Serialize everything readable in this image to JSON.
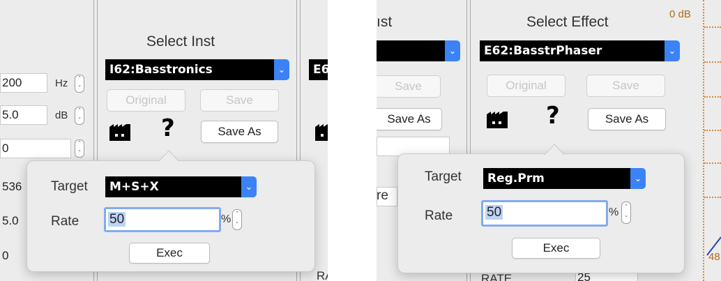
{
  "left": {
    "title": "Select Inst",
    "selected": "I62:Basstronics",
    "next_popup_text": "E6",
    "original_label": "Original",
    "save_label": "Save",
    "save_as_label": "Save As",
    "help_glyph": "?",
    "fields": [
      {
        "value": "200",
        "unit": "Hz"
      },
      {
        "value": "5.0",
        "unit": "dB"
      },
      {
        "value": "0",
        "unit": ""
      },
      {
        "value": "536",
        "unit": ""
      },
      {
        "value": "5.0",
        "unit": ""
      },
      {
        "value": "0",
        "unit": ""
      }
    ],
    "bottom_text": "RA",
    "popover": {
      "target_label": "Target",
      "target_value": "M+S+X",
      "rate_label": "Rate",
      "rate_value": "50",
      "rate_unit": "%",
      "exec_label": "Exec"
    }
  },
  "right": {
    "title": "Select Effect",
    "cut_title": "ıst",
    "selected": "E62:BasstrPhaser",
    "original_label": "Original",
    "save_label": "Save",
    "save_left_label": "Save",
    "save_as_left_label": "Save As",
    "save_as_label": "Save As",
    "help_glyph": "?",
    "db_label": "0 dB",
    "side_text": "re",
    "side_text_bottom": "48",
    "bottom_label": "RATE",
    "bottom_value": "25",
    "popover": {
      "target_label": "Target",
      "target_value": "Reg.Prm",
      "rate_label": "Rate",
      "rate_value": "50",
      "rate_unit": "%",
      "exec_label": "Exec"
    }
  }
}
